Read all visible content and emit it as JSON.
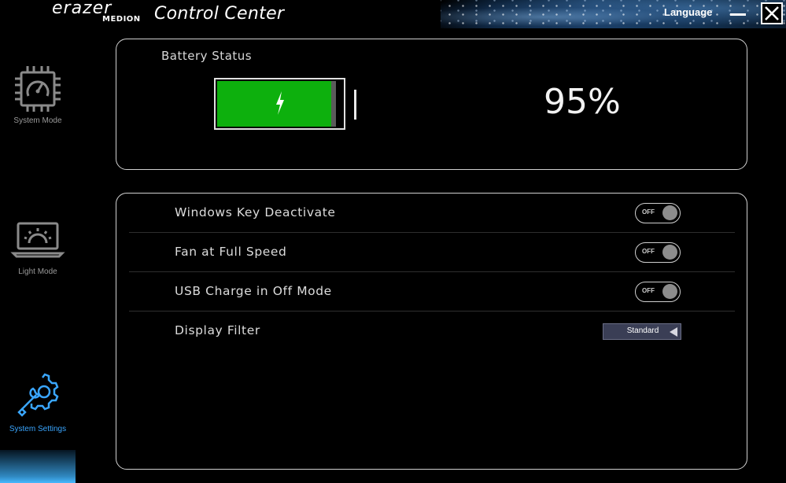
{
  "titlebar": {
    "logo_brand": "erazer",
    "logo_sub": "MEDION",
    "app_title": "Control Center",
    "language_label": "Language"
  },
  "sidebar": {
    "items": [
      {
        "label": "System Mode",
        "icon": "cpu-gauge-icon",
        "active": false
      },
      {
        "label": "Light Mode",
        "icon": "laptop-sun-icon",
        "active": false
      },
      {
        "label": "System Settings",
        "icon": "gears-wrench-icon",
        "active": true
      }
    ]
  },
  "battery": {
    "title": "Battery Status",
    "percent_text": "95%",
    "level": 0.95,
    "charging": true,
    "fill_color": "#0db00d"
  },
  "settings": {
    "rows": [
      {
        "label": "Windows Key Deactivate",
        "control": "toggle",
        "state": "OFF"
      },
      {
        "label": "Fan at Full Speed",
        "control": "toggle",
        "state": "OFF"
      },
      {
        "label": "USB Charge in Off Mode",
        "control": "toggle",
        "state": "OFF"
      },
      {
        "label": "Display Filter",
        "control": "select",
        "value": "Standard"
      }
    ]
  },
  "colors": {
    "accent": "#3aa6ff",
    "panel_border": "#d0d0d0",
    "select_bg": "#3a3e55"
  }
}
